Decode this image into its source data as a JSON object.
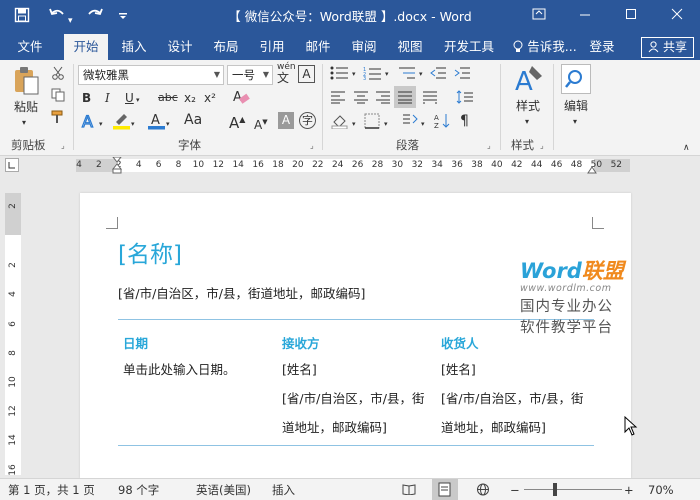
{
  "titlebar": {
    "title": "【 微信公众号：Word联盟 】.docx - Word",
    "save_icon": "save-icon",
    "undo_icon": "undo-icon",
    "redo_icon": "redo-icon",
    "customize_icon": "customize-qat-icon",
    "restore_icon": "ribbon-display-icon",
    "minimize_icon": "minimize-icon",
    "maximize_icon": "maximize-icon",
    "close_icon": "close-icon"
  },
  "tabs": [
    "文件",
    "开始",
    "插入",
    "设计",
    "布局",
    "引用",
    "邮件",
    "审阅",
    "视图",
    "开发工具"
  ],
  "active_tab": "开始",
  "tell_me": "告诉我...",
  "login": "登录",
  "share": "共享",
  "ribbon": {
    "clipboard": {
      "paste": "粘贴",
      "label": "剪贴板"
    },
    "font": {
      "font_name": "微软雅黑",
      "font_size": "一号",
      "phonetic": "wén",
      "bold": "B",
      "italic": "I",
      "underline": "U",
      "strike": "abc",
      "sub": "x₂",
      "sup": "x²",
      "grow": "A",
      "shrink": "A",
      "case": "Aa",
      "label": "字体"
    },
    "paragraph": {
      "label": "段落"
    },
    "styles": {
      "button": "样式",
      "label": "样式"
    },
    "editing": {
      "button": "编辑"
    }
  },
  "ruler": {
    "h_ticks": [
      "4",
      "2",
      "2",
      "4",
      "6",
      "8",
      "10",
      "12",
      "14",
      "16",
      "18",
      "20",
      "22",
      "24",
      "26",
      "28",
      "30",
      "32",
      "34",
      "36",
      "38",
      "40",
      "42",
      "44",
      "46",
      "48",
      "50",
      "52"
    ],
    "v_ticks": [
      "2",
      "2",
      "4",
      "6",
      "8",
      "10",
      "12",
      "14",
      "16"
    ]
  },
  "document": {
    "title": "[名称]",
    "address": "[省/市/自治区，市/县，街道地址，邮政编码]",
    "columns": [
      {
        "head": "日期",
        "lines": [
          "单击此处输入日期。"
        ]
      },
      {
        "head": "接收方",
        "lines": [
          "[姓名]",
          "[省/市/自治区，市/县，街",
          "道地址，邮政编码]"
        ]
      },
      {
        "head": "收货人",
        "lines": [
          "[姓名]",
          "[省/市/自治区，市/县，街",
          "道地址，邮政编码]"
        ]
      }
    ]
  },
  "watermark": {
    "word": "Word",
    "brand": "联盟",
    "url": "www.wordlm.com",
    "line1": "国内专业办公",
    "line2": "软件教学平台",
    "color_word": "#2aa2d8",
    "color_brand": "#f08a1e"
  },
  "statusbar": {
    "page": "第 1 页，共 1 页",
    "words": "98 个字",
    "language": "英语(美国)",
    "mode": "插入",
    "zoom": "70%",
    "zoom_minus": "−",
    "zoom_plus": "+"
  },
  "colors": {
    "brand_blue": "#2b579a",
    "heading_blue": "#29a7d9"
  }
}
